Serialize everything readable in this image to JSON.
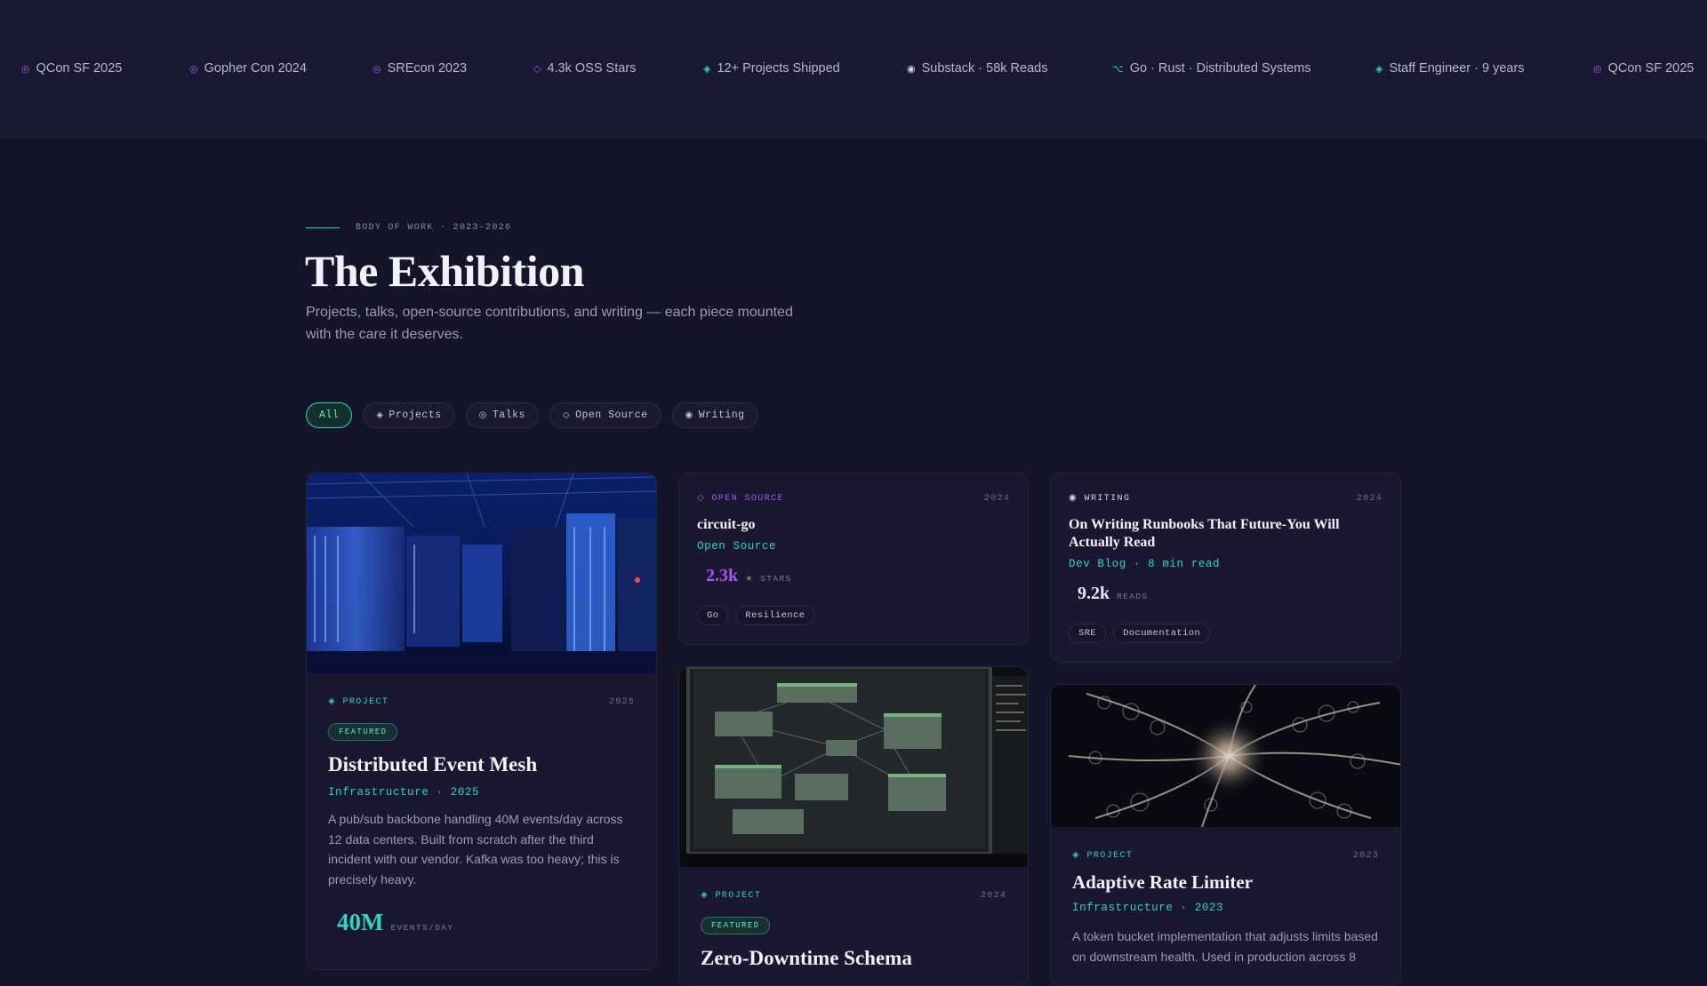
{
  "ticker": [
    {
      "icon": "target-icon",
      "glyph": "◎",
      "color": "purple",
      "label": "QCon SF 2025"
    },
    {
      "icon": "target-icon",
      "glyph": "◎",
      "color": "purple",
      "label": "Gopher Con 2024"
    },
    {
      "icon": "target-icon",
      "glyph": "◎",
      "color": "purple",
      "label": "SREcon 2023"
    },
    {
      "icon": "diamond-outline-icon",
      "glyph": "◇",
      "color": "purple",
      "label": "4.3k OSS Stars"
    },
    {
      "icon": "diamond-icon",
      "glyph": "◈",
      "color": "teal",
      "label": "12+ Projects Shipped"
    },
    {
      "icon": "dot-icon",
      "glyph": "◉",
      "color": "white",
      "label": "Substack · 58k Reads"
    },
    {
      "icon": "branch-icon",
      "glyph": "⌥",
      "color": "teal",
      "label": "Go · Rust · Distributed Systems"
    },
    {
      "icon": "diamond-icon",
      "glyph": "◈",
      "color": "teal",
      "label": "Staff Engineer · 9 years"
    },
    {
      "icon": "target-icon",
      "glyph": "◎",
      "color": "purple",
      "label": "QCon SF 2025"
    }
  ],
  "header": {
    "eyebrow": "BODY OF WORK · 2023–2026",
    "title": "The Exhibition",
    "subtitle": "Projects, talks, open-source contributions, and writing — each piece mounted with the care it deserves."
  },
  "filters": [
    {
      "label": "All",
      "glyph": "",
      "active": true
    },
    {
      "label": "Projects",
      "glyph": "◈",
      "icon": "diamond-icon"
    },
    {
      "label": "Talks",
      "glyph": "◎",
      "icon": "target-icon"
    },
    {
      "label": "Open Source",
      "glyph": "◇",
      "icon": "diamond-outline-icon"
    },
    {
      "label": "Writing",
      "glyph": "◉",
      "icon": "dot-icon"
    }
  ],
  "cards": {
    "event_mesh": {
      "category_glyph": "◈",
      "category": "PROJECT",
      "year": "2025",
      "badge": "FEATURED",
      "title": "Distributed Event Mesh",
      "meta": "Infrastructure · 2025",
      "description": "A pub/sub backbone handling 40M events/day across 12 data centers. Built from scratch after the third incident with our vendor. Kafka was too heavy; this is precisely heavy.",
      "stat_value": "40M",
      "stat_label": "EVENTS/DAY"
    },
    "circuit_go": {
      "category_glyph": "◇",
      "category": "OPEN SOURCE",
      "year": "2024",
      "title": "circuit-go",
      "meta": "Open Source",
      "stat_value": "2.3k",
      "stat_label": "★ STARS",
      "tags": [
        "Go",
        "Resilience"
      ]
    },
    "runbooks": {
      "category_glyph": "◉",
      "category": "WRITING",
      "year": "2024",
      "title": "On Writing Runbooks That Future-You Will Actually Read",
      "meta": "Dev Blog · 8 min read",
      "stat_value": "9.2k",
      "stat_label": "READS",
      "tags": [
        "SRE",
        "Documentation"
      ]
    },
    "schema": {
      "category_glyph": "◈",
      "category": "PROJECT",
      "year": "2024",
      "badge": "FEATURED",
      "title": "Zero-Downtime Schema"
    },
    "rate_limiter": {
      "category_glyph": "◈",
      "category": "PROJECT",
      "year": "2023",
      "title": "Adaptive Rate Limiter",
      "meta": "Infrastructure · 2023",
      "description": "A token bucket implementation that adjusts limits based on downstream health. Used in production across 8"
    }
  },
  "colors": {
    "accent_teal": "#2dd4bf",
    "accent_purple": "#a855f7",
    "background": "#15152a",
    "card": "#1a1731"
  }
}
